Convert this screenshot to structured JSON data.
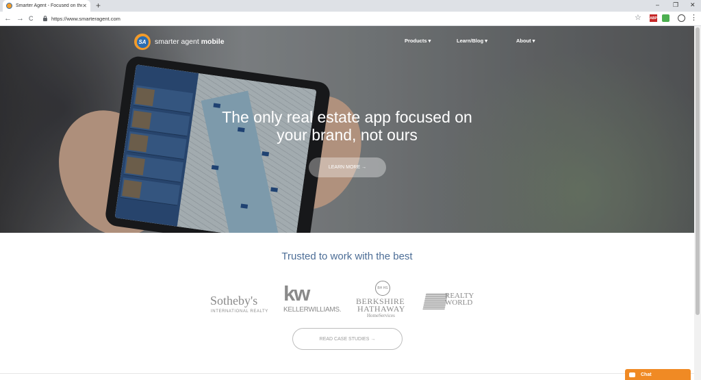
{
  "browser": {
    "tab_title": "Smarter Agent - Focused on the",
    "tab_close": "✕",
    "new_tab": "+",
    "url": "https://www.smarteragent.com",
    "minimize": "–",
    "restore": "❐",
    "close": "✕",
    "back": "←",
    "forward": "→",
    "reload": "C",
    "star": "☆",
    "ext_label": "ABP",
    "menu": "⋮"
  },
  "site": {
    "logo_mark": "SA",
    "logo_text_light": "smarter agent ",
    "logo_text_bold": "mobile",
    "nav": [
      "Products ▾",
      "Learn/Blog ▾",
      "About ▾"
    ],
    "hero_title_line1": "The only real estate app focused on",
    "hero_title_line2": "your brand, not ours",
    "learn_more": "LEARN MORE →",
    "trusted_heading": "Trusted to work with the best",
    "brands": {
      "sothebys_main": "Sotheby's",
      "sothebys_sub": "INTERNATIONAL REALTY",
      "kw_mark": "kw",
      "kw_text": "KELLERWILLIAMS.",
      "bh_mark": "BH HS",
      "bh_line1": "BERKSHIRE",
      "bh_line2": "HATHAWAY",
      "bh_line3": "HomeServices",
      "rw_line1": "REALTY",
      "rw_line2": "WORLD"
    },
    "case_studies": "READ CASE STUDIES →",
    "chat": "Chat"
  },
  "colors": {
    "accent_orange": "#f08a24",
    "heading_blue": "#4c6d96",
    "logo_blue": "#2b6cb0"
  }
}
